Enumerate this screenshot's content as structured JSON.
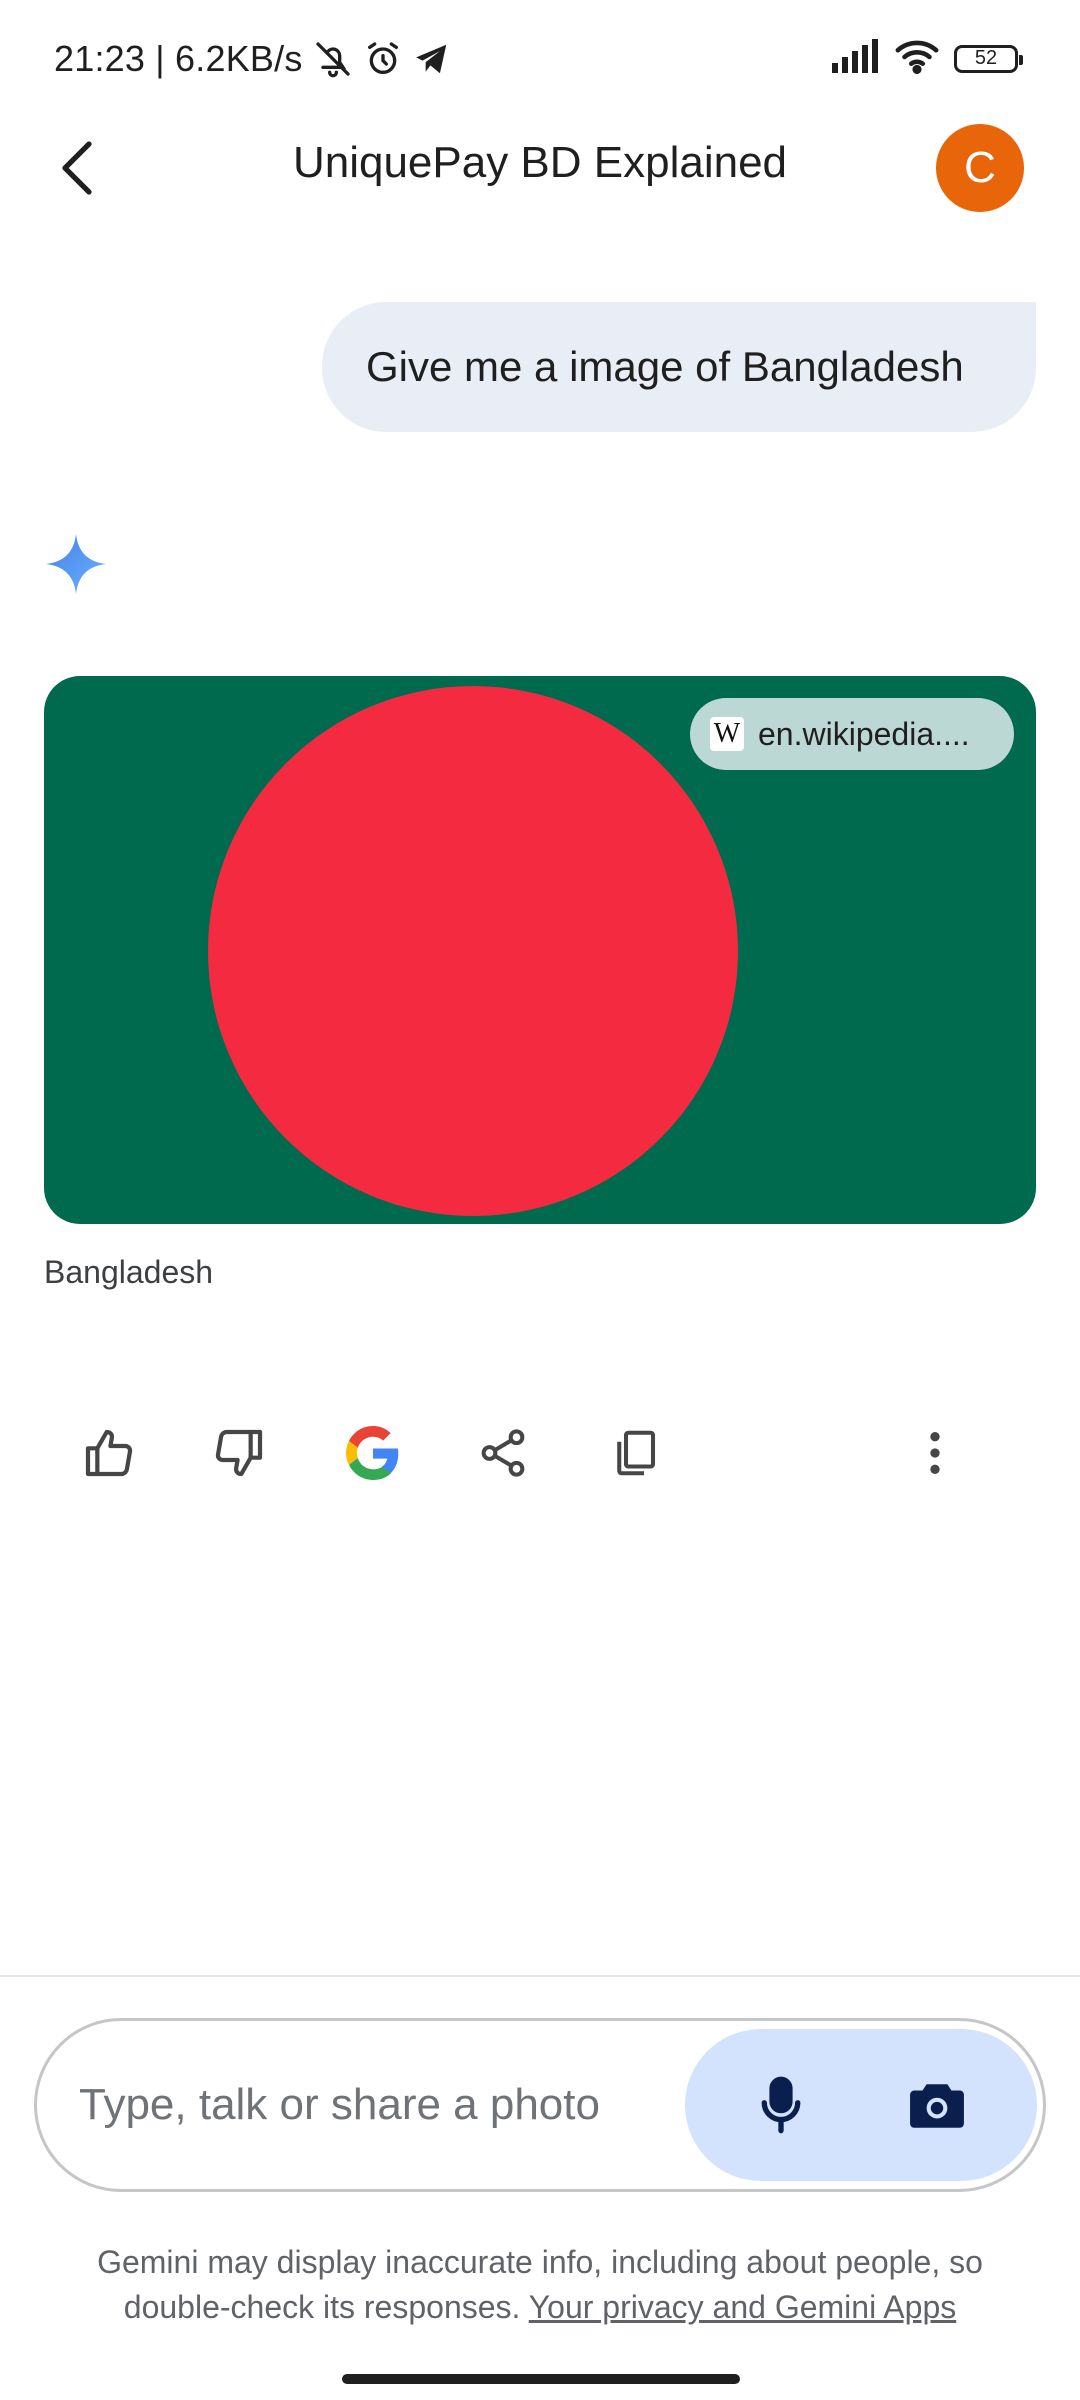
{
  "status_bar": {
    "time_speed": "21:23 | 6.2KB/s",
    "battery": "52",
    "icons": [
      "silent-icon",
      "alarm-icon",
      "telegram-icon",
      "signal-icon",
      "wifi-icon",
      "battery-icon"
    ]
  },
  "header": {
    "title": "UniquePay BD Explained",
    "avatar_letter": "C",
    "avatar_color": "#e8650a"
  },
  "conversation": {
    "user_message": "Give me a image of Bangladesh",
    "response": {
      "image": {
        "source_label": "en.wikipedia....",
        "caption": "Bangladesh",
        "colors": {
          "field": "#006a4e",
          "disc": "#f42a41"
        }
      },
      "actions": [
        "thumbs-up-icon",
        "thumbs-down-icon",
        "google-icon",
        "share-icon",
        "copy-icon",
        "more-icon"
      ]
    }
  },
  "composer": {
    "placeholder": "Type, talk or share a photo"
  },
  "footer": {
    "disclaimer": "Gemini may display inaccurate info, including about people, so double-check its responses.",
    "privacy_link": "Your privacy and Gemini Apps"
  }
}
